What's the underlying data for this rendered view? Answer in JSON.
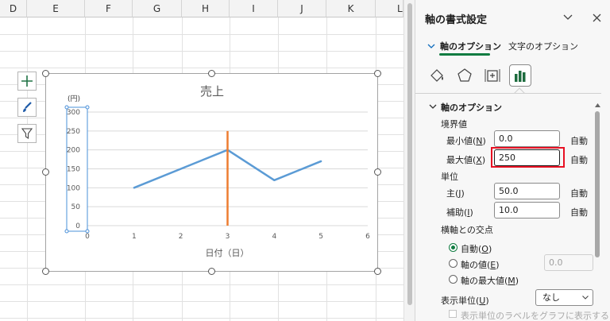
{
  "sheet": {
    "columns": [
      "D",
      "E",
      "F",
      "G",
      "H",
      "I",
      "J",
      "K",
      "L"
    ]
  },
  "chart_tools": {
    "add_element": "chart-elements",
    "style": "chart-styles",
    "filter": "chart-filters"
  },
  "chart_data": {
    "type": "scatter-line",
    "title": "売上",
    "xlabel": "日付（日）",
    "ylabel": "(円)",
    "xlim": [
      0,
      6
    ],
    "ylim": [
      0,
      300
    ],
    "xticks": [
      "0",
      "1",
      "2",
      "3",
      "4",
      "5",
      "6"
    ],
    "yticks": [
      "0",
      "50",
      "100",
      "150",
      "200",
      "250",
      "300"
    ],
    "grid": true,
    "series": [
      {
        "x": [
          1,
          3,
          4,
          5
        ],
        "y": [
          100,
          200,
          120,
          170
        ],
        "color": "#5b9bd5"
      }
    ],
    "vertical_line": {
      "x": 3,
      "y0": 0,
      "y1": 250,
      "color": "#ed7d31"
    }
  },
  "pane": {
    "title": "軸の書式設定",
    "tab_axis_options": "軸のオプション",
    "tab_text_options": "文字のオプション",
    "section_title": "軸のオプション",
    "bounds_label": "境界値",
    "min": {
      "label": "最小値",
      "key": "N",
      "value": "0.0",
      "auto": "自動"
    },
    "max": {
      "label": "最大値",
      "key": "X",
      "value": "250",
      "auto": "自動"
    },
    "units_label": "単位",
    "major": {
      "label": "主",
      "key": "J",
      "value": "50.0",
      "auto": "自動"
    },
    "minor": {
      "label": "補助",
      "key": "I",
      "value": "10.0",
      "auto": "自動"
    },
    "crosses_label": "横軸との交点",
    "cross_auto": {
      "label": "自動",
      "key": "O"
    },
    "cross_value": {
      "label": "軸の値",
      "key": "E",
      "value": "0.0"
    },
    "cross_max": {
      "label": "軸の最大値",
      "key": "M"
    },
    "display_units": {
      "label": "表示単位",
      "key": "U",
      "value": "なし"
    },
    "show_units_label": "表示単位のラベルをグラフに表示する",
    "accent": "#107c41",
    "highlight": "#e81123"
  }
}
